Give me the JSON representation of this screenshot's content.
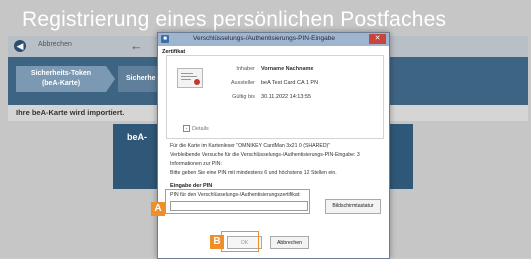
{
  "page": {
    "title": "Registrierung eines persönlichen Postfaches",
    "nav": {
      "back_label": "Abbrechen",
      "back_glyph": "◀",
      "forward_glyph": "←"
    },
    "steps": [
      {
        "line1": "Sicherheits-Token",
        "line2": "(beA-Karte)"
      },
      {
        "label": "Sicherhe"
      }
    ],
    "status": "Ihre beA-Karte wird importiert.",
    "bea_label": "beA-"
  },
  "dialog": {
    "title": "Verschlüsselungs-/Authentisierungs-PIN-Eingabe",
    "close_glyph": "✕",
    "certificate": {
      "heading": "Zertifikat",
      "rows": [
        {
          "key": "Inhaber",
          "value": "Vorname Nachname"
        },
        {
          "key": "Aussteller",
          "value": "beA Test Card CA 1 PN"
        },
        {
          "key": "Gültig bis",
          "value": "30.11.2022 14:13:55"
        }
      ],
      "details_label": "Details"
    },
    "info_lines": [
      "Für die Karte im Kartenleser \"OMNIKEY CardMan 3x21 0 (SHARED)\"",
      "Verbleibende Versuche für die Verschlüsselungs-/Authentisierungs-PIN-Eingabe: 3",
      "Informationen zur PIN:",
      "Bitte geben Sie eine PIN mit mindestens 6 und höchstens 12 Stellen ein."
    ],
    "pin_section_heading": "Eingabe der PIN",
    "pin_label": "PIN für den Verschlüsselungs-/Authentisierungszertifikat:",
    "pin_value": "",
    "keyboard_button": "Bildschirmtastatur",
    "ok_button": "OK",
    "cancel_button": "Abbrechen"
  },
  "annotations": {
    "marker_a": "A",
    "marker_b": "B",
    "color": "#ef8f2a"
  }
}
